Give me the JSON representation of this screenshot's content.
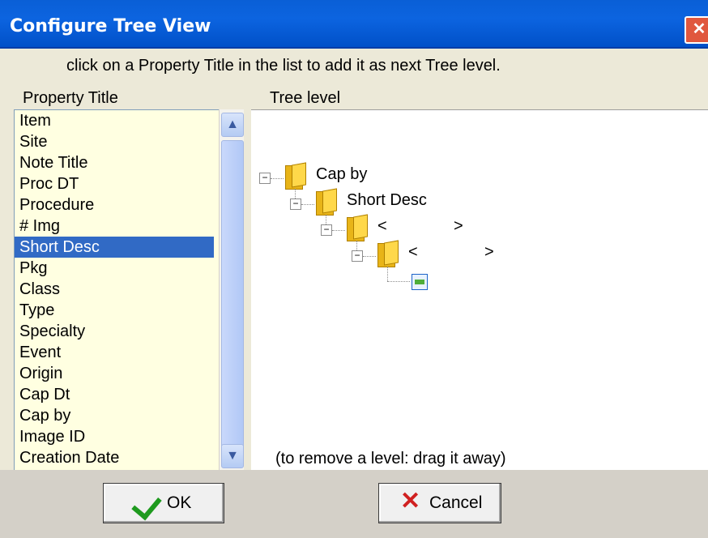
{
  "window": {
    "title": "Configure Tree View",
    "close_glyph": "✕",
    "instructions": "click on a Property Title in the list to add it as next Tree level."
  },
  "list": {
    "header": "Property Title",
    "items": [
      "Item",
      "Site",
      "Note Title",
      "Proc DT",
      "Procedure",
      "# Img",
      "Short Desc",
      "Pkg",
      "Class",
      "Type",
      "Specialty",
      "Event",
      "Origin",
      "Cap Dt",
      "Cap by",
      "Image ID",
      "Creation Date"
    ],
    "selected": "Short Desc"
  },
  "tree": {
    "header": "Tree level",
    "nodes": [
      {
        "label": "Cap by"
      },
      {
        "label": "Short Desc"
      },
      {
        "label": "<",
        "right": ">"
      },
      {
        "label": "<",
        "right": ">"
      }
    ],
    "hint": "(to remove a level:  drag it away)"
  },
  "buttons": {
    "ok": "OK",
    "cancel": "Cancel"
  },
  "icons": {
    "expander": "minus-expander-icon",
    "folder": "folder-icon",
    "image": "image-icon"
  }
}
